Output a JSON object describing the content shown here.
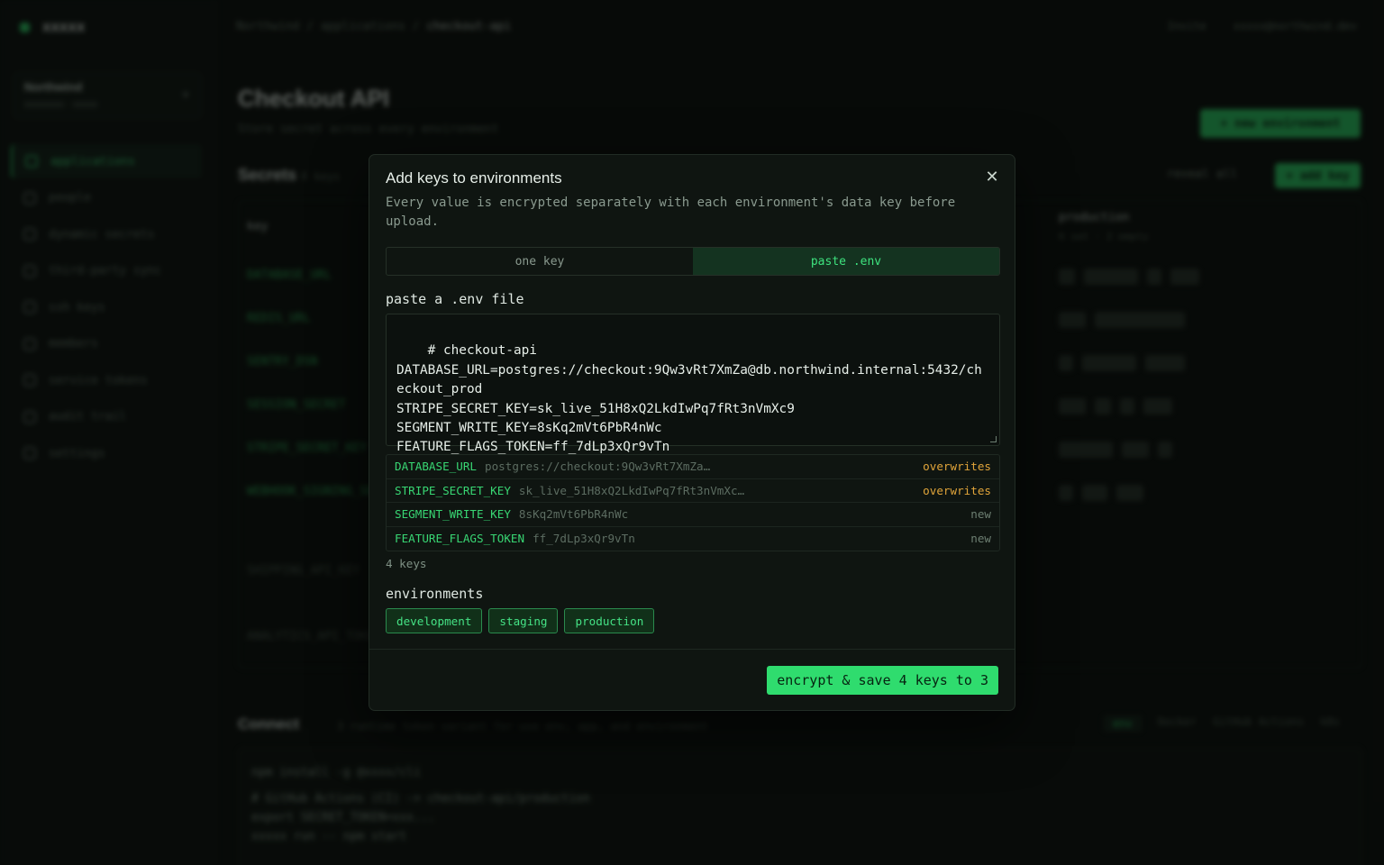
{
  "background": {
    "brand": "xxxxx",
    "org": {
      "name": "Northwind",
      "sub": "xxxxxxxx · xxxxx"
    },
    "nav": [
      "applications",
      "people",
      "dynamic secrets",
      "third-party sync",
      "ssh keys",
      "members",
      "service tokens",
      "audit trail",
      "settings"
    ],
    "breadcrumb": {
      "a": "Northwind",
      "b": "applications",
      "c": "checkout-api"
    },
    "top_right": [
      "Invite",
      "xxxxx@northwind.dev"
    ],
    "title": "Checkout API",
    "subtitle": "Store secret across every environment",
    "new_env_button": "+ new environment",
    "secrets_title": "Secrets",
    "secrets_count": "8 keys",
    "reveal_all": "reveal all",
    "add_key_button": "+ add key",
    "table_key_header": "key",
    "rows": [
      "DATABASE_URL",
      "REDIS_URL",
      "SENTRY_DSN",
      "SESSION_SECRET",
      "STRIPE_SECRET_KEY",
      "WEBHOOK_SIGNING_SECRET"
    ],
    "dim_rows": [
      "SHIPPING_API_KEY",
      "ANALYTICS_API_TOKEN"
    ],
    "prod_header": "production",
    "prod_sub": "6 set · 2 empty",
    "connect_title": "Connect",
    "connect_sub": "3 runtime token variant for use env, app, and environment",
    "connect_tabs": [
      "env",
      "Docker",
      "GitHub Actions",
      "k8s"
    ],
    "code_lines": [
      "npm install -g @xxxx/cli",
      "# GitHub Actions (CI) -> checkout-api/production",
      "export SECRET_TOKEN=xxx...",
      "xxxxx run -- npm start"
    ]
  },
  "modal": {
    "title": "Add keys to environments",
    "description": "Every value is encrypted separately with each environment's data key before upload.",
    "tabs": [
      {
        "label": "one key",
        "active": false
      },
      {
        "label": "paste .env",
        "active": true
      }
    ],
    "paste_label": "paste a .env file",
    "env_text": "# checkout-api\nDATABASE_URL=postgres://checkout:9Qw3vRt7XmZa@db.northwind.internal:5432/checkout_prod\nSTRIPE_SECRET_KEY=sk_live_51H8xQ2LkdIwPq7fRt3nVmXc9\nSEGMENT_WRITE_KEY=8sKq2mVt6PbR4nWc\nFEATURE_FLAGS_TOKEN=ff_7dLp3xQr9vTn",
    "parsed_keys": [
      {
        "name": "DATABASE_URL",
        "value": "postgres://checkout:9Qw3vRt7XmZa…",
        "status": "overwrites"
      },
      {
        "name": "STRIPE_SECRET_KEY",
        "value": "sk_live_51H8xQ2LkdIwPq7fRt3nVmXc…",
        "status": "overwrites"
      },
      {
        "name": "SEGMENT_WRITE_KEY",
        "value": "8sKq2mVt6PbR4nWc",
        "status": "new"
      },
      {
        "name": "FEATURE_FLAGS_TOKEN",
        "value": "ff_7dLp3xQr9vTn",
        "status": "new"
      }
    ],
    "key_count": "4 keys",
    "environments_label": "environments",
    "environments": [
      "development",
      "staging",
      "production"
    ],
    "submit_label": "encrypt & save 4 keys to 3"
  },
  "colors": {
    "accent": "#2fdc6e",
    "overwrite": "#e0a43a",
    "modal_bg": "#0f1511",
    "page_bg": "#0b0f0c"
  }
}
